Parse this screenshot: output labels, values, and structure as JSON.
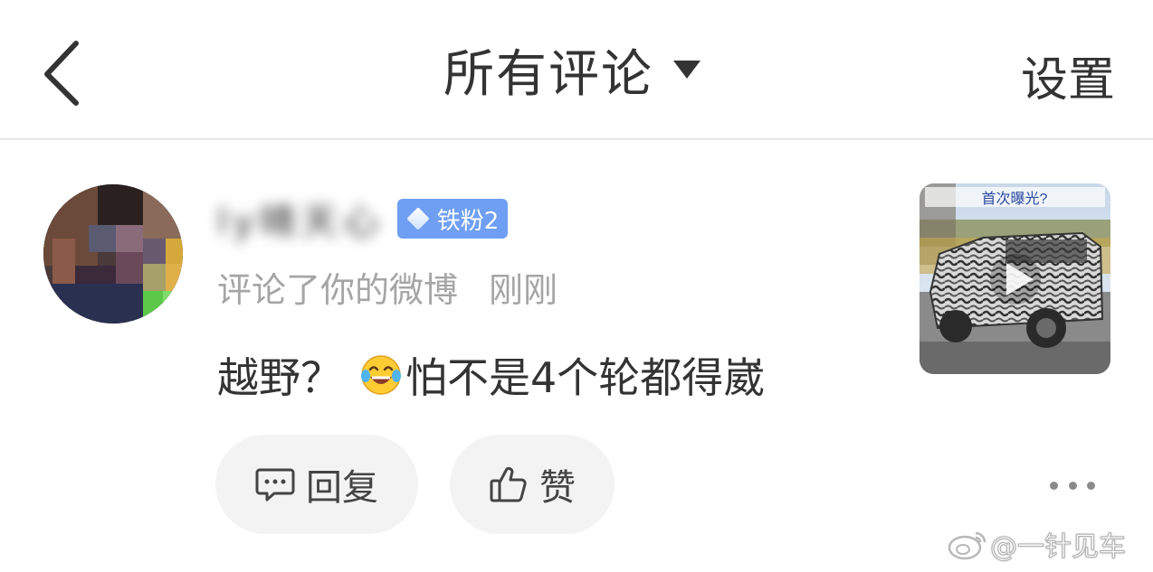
{
  "header": {
    "title": "所有评论",
    "settings_label": "设置"
  },
  "notification": {
    "username": "ly晴天心",
    "fan_badge": "铁粉2",
    "action_text": "评论了你的微博",
    "time": "刚刚",
    "comment_before_emoji": "越野？",
    "comment_after_emoji": "怕不是4个轮都得崴",
    "thumbnail_caption": "首次曝光?",
    "reply_label": "回复",
    "like_label": "赞"
  },
  "watermark": "@一针见车",
  "colors": {
    "badge_bg": "#6e9ff3",
    "meta_text": "#a5a5a5",
    "button_bg": "#f3f3f3"
  },
  "icons": {
    "back": "chevron-left-icon",
    "dropdown": "caret-down-icon",
    "badge": "diamond-icon",
    "emoji": "tears-of-joy-icon",
    "reply": "comment-icon",
    "like": "thumbs-up-icon",
    "more": "more-dots-icon",
    "play": "play-icon",
    "weibo": "weibo-logo-icon"
  }
}
